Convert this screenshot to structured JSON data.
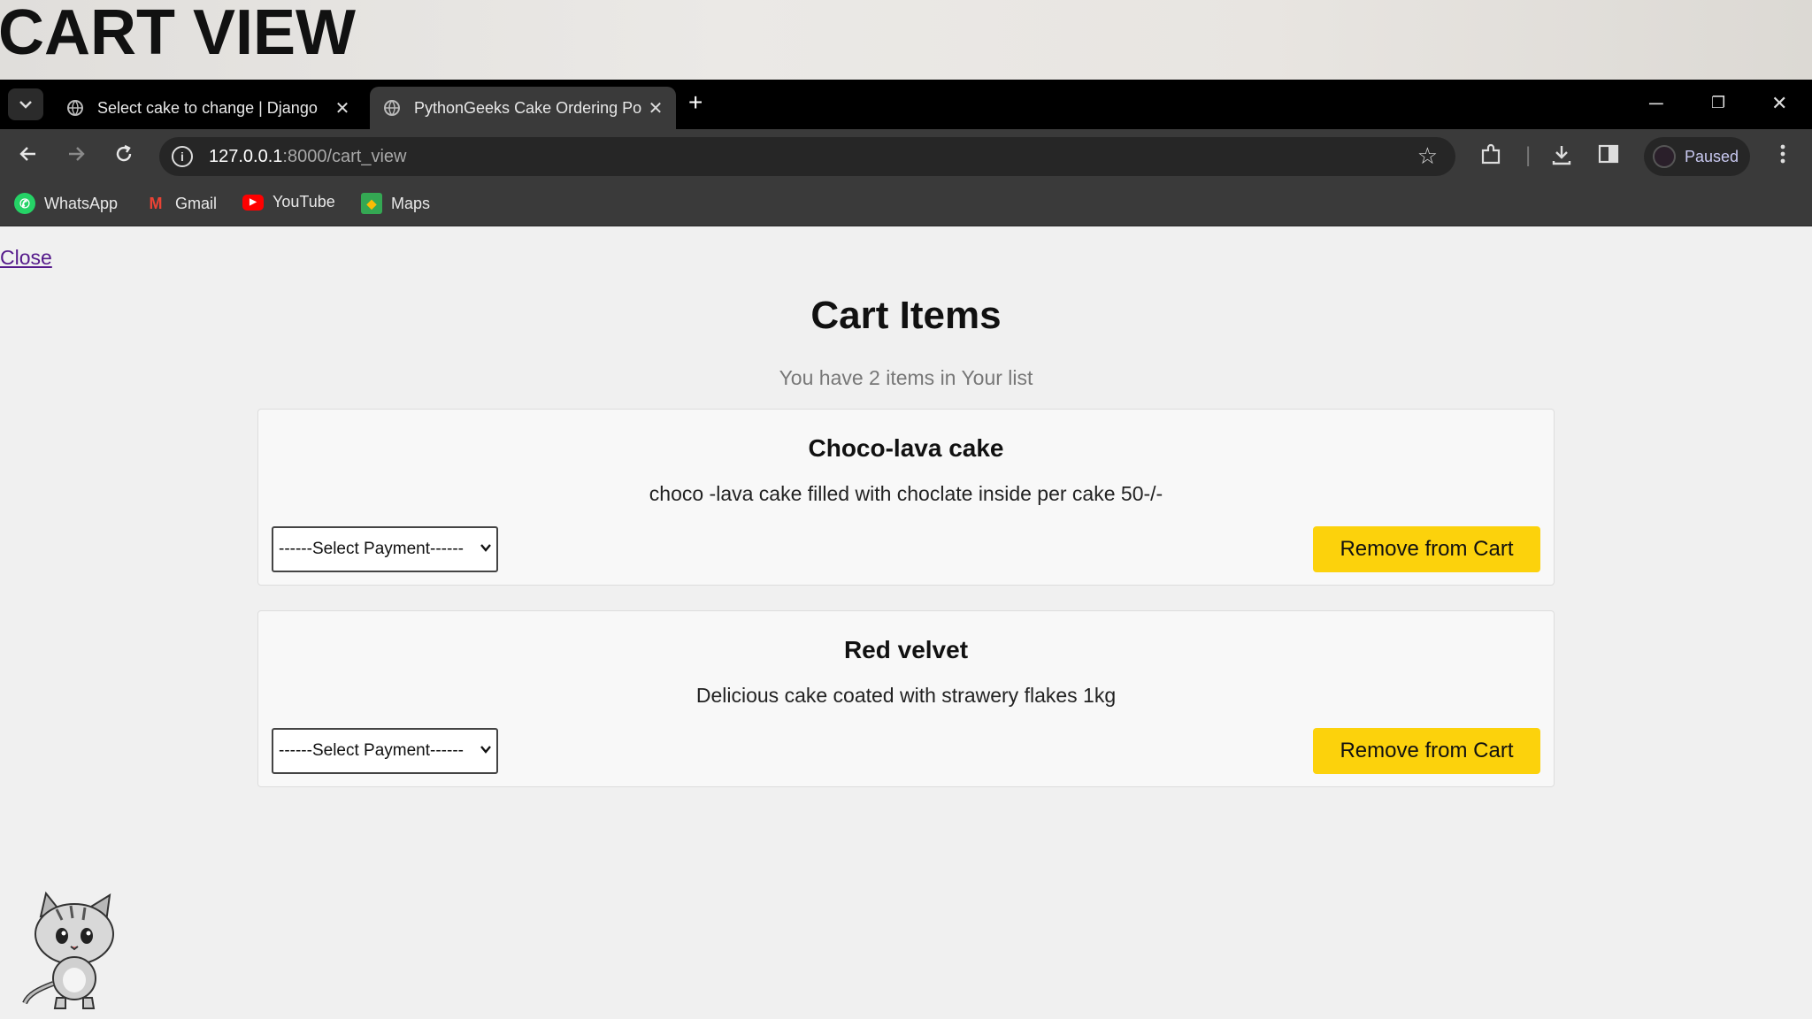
{
  "banner": {
    "title": "CART VIEW"
  },
  "browser": {
    "tabs": [
      {
        "title": "Select cake to change | Django"
      },
      {
        "title": "PythonGeeks Cake Ordering Po"
      }
    ],
    "url_host": "127.0.0.1",
    "url_path": ":8000/cart_view",
    "profile_status": "Paused",
    "bookmarks": [
      {
        "label": "WhatsApp"
      },
      {
        "label": "Gmail"
      },
      {
        "label": "YouTube"
      },
      {
        "label": "Maps"
      }
    ]
  },
  "page": {
    "close_label": "Close",
    "heading": "Cart Items",
    "subtitle": "You have 2 items in Your list",
    "items": [
      {
        "name": "Choco-lava cake",
        "description": "choco -lava cake filled with choclate inside per cake 50-/-",
        "payment_selected": "------Select Payment------",
        "remove_label": "Remove from Cart"
      },
      {
        "name": "Red velvet",
        "description": "Delicious cake coated with strawery flakes 1kg",
        "payment_selected": "------Select Payment------",
        "remove_label": "Remove from Cart"
      }
    ]
  },
  "colors": {
    "button_yellow": "#fcd20c",
    "link_purple": "#551a8b",
    "chrome_dark": "#3a3a3a"
  }
}
